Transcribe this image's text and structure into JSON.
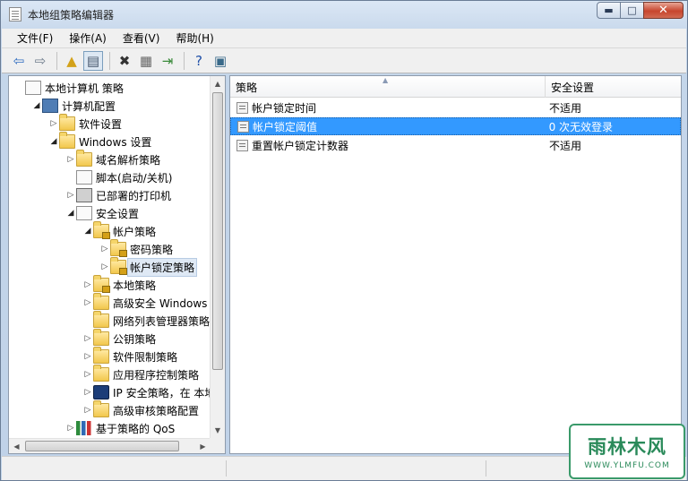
{
  "window": {
    "title": "本地组策略编辑器",
    "minimize_glyph": "▬",
    "maximize_glyph": "□",
    "close_glyph": "✕"
  },
  "menu": {
    "items": [
      "文件(F)",
      "操作(A)",
      "查看(V)",
      "帮助(H)"
    ]
  },
  "toolbar": {
    "buttons": [
      {
        "name": "back-icon",
        "glyph": "⇦",
        "color": "#2f6cc0"
      },
      {
        "name": "forward-icon",
        "glyph": "⇨",
        "color": "#6c7a8a"
      },
      {
        "name": "up-folder-icon",
        "glyph": "▲",
        "color": "#d3a21a"
      },
      {
        "name": "show-hide-tree-icon",
        "glyph": "▤",
        "color": "#44546a"
      },
      {
        "name": "delete-icon",
        "glyph": "✖",
        "color": "#333333"
      },
      {
        "name": "properties-icon",
        "glyph": "▦",
        "color": "#666666"
      },
      {
        "name": "export-list-icon",
        "glyph": "⇥",
        "color": "#3a8a3a"
      },
      {
        "name": "help-icon",
        "glyph": "?",
        "color": "#1f4fa8"
      },
      {
        "name": "console-icon",
        "glyph": "▣",
        "color": "#3a6a8a"
      }
    ]
  },
  "tree": {
    "rows": [
      {
        "label": "本地计算机 策略",
        "level": 0,
        "arrow": "",
        "icon": "doc"
      },
      {
        "label": "计算机配置",
        "level": 1,
        "arrow": "◢",
        "icon": "computer"
      },
      {
        "label": "软件设置",
        "level": 2,
        "arrow": "▷",
        "icon": "folder"
      },
      {
        "label": "Windows 设置",
        "level": 2,
        "arrow": "◢",
        "icon": "folder"
      },
      {
        "label": "域名解析策略",
        "level": 3,
        "arrow": "▷",
        "icon": "folder"
      },
      {
        "label": "脚本(启动/关机)",
        "level": 3,
        "arrow": "",
        "icon": "doc"
      },
      {
        "label": "已部署的打印机",
        "level": 3,
        "arrow": "▷",
        "icon": "printer"
      },
      {
        "label": "安全设置",
        "level": 3,
        "arrow": "◢",
        "icon": "doc"
      },
      {
        "label": "帐户策略",
        "level": 4,
        "arrow": "◢",
        "icon": "folder lock"
      },
      {
        "label": "密码策略",
        "level": 5,
        "arrow": "▷",
        "icon": "folder lock"
      },
      {
        "label": "帐户锁定策略",
        "level": 5,
        "arrow": "▷",
        "icon": "folder lock",
        "selected": true
      },
      {
        "label": "本地策略",
        "level": 4,
        "arrow": "▷",
        "icon": "folder lock"
      },
      {
        "label": "高级安全 Windows 防",
        "level": 4,
        "arrow": "▷",
        "icon": "folder"
      },
      {
        "label": "网络列表管理器策略",
        "level": 4,
        "arrow": "",
        "icon": "folder"
      },
      {
        "label": "公钥策略",
        "level": 4,
        "arrow": "▷",
        "icon": "folder"
      },
      {
        "label": "软件限制策略",
        "level": 4,
        "arrow": "▷",
        "icon": "folder"
      },
      {
        "label": "应用程序控制策略",
        "level": 4,
        "arrow": "▷",
        "icon": "folder"
      },
      {
        "label": "IP 安全策略，在 本地计",
        "level": 4,
        "arrow": "▷",
        "icon": "ipicon"
      },
      {
        "label": "高级审核策略配置",
        "level": 4,
        "arrow": "▷",
        "icon": "folder"
      },
      {
        "label": "基于策略的 QoS",
        "level": 3,
        "arrow": "▷",
        "icon": "bars"
      }
    ]
  },
  "list": {
    "columns": [
      "策略",
      "安全设置"
    ],
    "sort_glyph": "▲",
    "rows": [
      {
        "policy": "帐户锁定时间",
        "setting": "不适用"
      },
      {
        "policy": "帐户锁定阈值",
        "setting": "0 次无效登录",
        "selected": true
      },
      {
        "policy": "重置帐户锁定计数器",
        "setting": "不适用"
      }
    ]
  },
  "scroll": {
    "up": "▲",
    "down": "▼",
    "left": "◀",
    "right": "▶"
  },
  "watermark": {
    "big": "雨林木风",
    "small": "WWW.YLMFU.COM"
  }
}
